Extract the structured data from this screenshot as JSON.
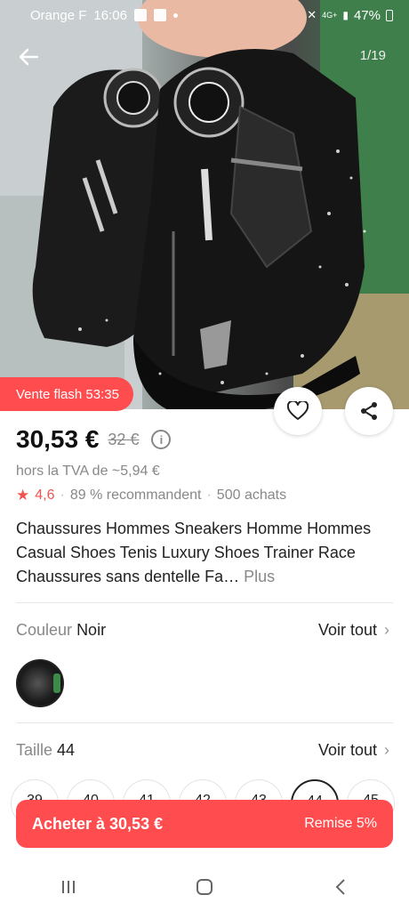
{
  "status_bar": {
    "carrier": "Orange F",
    "time": "16:06",
    "network": "4G+",
    "battery": "47%"
  },
  "gallery": {
    "counter": "1/19"
  },
  "flash_sale": {
    "label": "Vente flash 53:35"
  },
  "price": {
    "current": "30,53 €",
    "original": "32 €",
    "tax_note": "hors la TVA de ~5,94 €"
  },
  "rating": {
    "score": "4,6",
    "recommend": "89 % recommandent",
    "purchases": "500 achats"
  },
  "product": {
    "title": "Chaussures Hommes Sneakers Homme Hommes Casual Shoes Tenis Luxury Shoes Trainer Race Chaussures sans dentelle Fa…",
    "more_label": "Plus"
  },
  "color": {
    "label": "Couleur",
    "value": "Noir",
    "see_all": "Voir tout"
  },
  "size": {
    "label": "Taille",
    "value": "44",
    "see_all": "Voir tout",
    "options": [
      "39",
      "40",
      "41",
      "42",
      "43",
      "44",
      "45"
    ],
    "selected": "44"
  },
  "cta": {
    "buy_label": "Acheter à 30,53 €",
    "discount_label": "Remise 5%"
  },
  "colors": {
    "accent": "#ff4d4f",
    "star": "#f0544f"
  }
}
